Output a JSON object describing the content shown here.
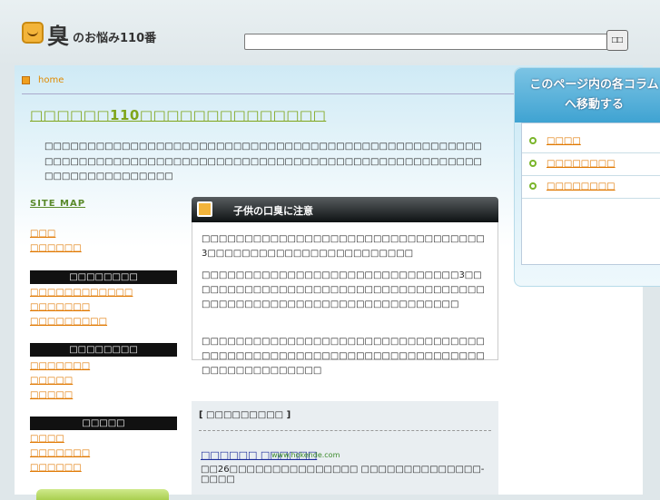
{
  "header": {
    "logo_kanji": "臭",
    "logo_text": "のお悩み110番",
    "search_value": "",
    "search_button": "□□"
  },
  "breadcrumb": {
    "home": "home"
  },
  "page_title": "□□□□□□110□□□□□□□□□□□□□□",
  "intro": "□□□□□□□□□□□□□□□□□□□□□□□□□□□□□□□□□□□□□□□□□□□□□□□□□□□□□□□□□□□□□□□□□□□□□□□□□□□□□□□□□□□□□□□□□□□□□□□□□□□□□□□□□□□□□□□□□□□□□",
  "sidebar": {
    "sitemap": "SITE MAP",
    "top_links": [
      "□□□",
      "□□□□□□"
    ],
    "groups": [
      {
        "title": "□□□□□□□□",
        "links": [
          "□□□□□□□□□□□□",
          "□□□□□□□",
          "□□□□□□□□□"
        ]
      },
      {
        "title": "□□□□□□□□",
        "links": [
          "□□□□□□□",
          "□□□□□",
          "□□□□□"
        ]
      },
      {
        "title": "□□□□□",
        "links": [
          "□□□□",
          "□□□□□□□",
          "□□□□□□"
        ]
      }
    ]
  },
  "article": {
    "title": "子供の口臭に注意",
    "paragraphs": [
      "□□□□□□□□□□□□□□□□□□□□□□□□□□□□□□□□□3□□□□□□□□□□□□□□□□□□□□□□□□",
      "□□□□□□□□□□□□□□□□□□□□□□□□□□□□□□3□□□□□□□□□□□□□□□□□□□□□□□□□□□□□□□□□□□□□□□□□□□□□□□□□□□□□□□□□□□□□□□□□",
      "□□□□□□□□□□□□□□□□□□□□□□□□□□□□□□□□□□□□□□□□□□□□□□□□□□□□□□□□□□□□□□□□□□□□□□□□□□□□□□□□"
    ]
  },
  "ad": {
    "heading": "[ □□□□□□□□□ ]",
    "link": "□□□□□□ □□□□□□",
    "url": "www.hokende.com",
    "desc": "□□26□□□□□□□□□□□□□□□ □□□□□□□□□□□□□□-□□□□"
  },
  "toc": {
    "title_line1": "このページ内の各コラム",
    "title_line2": "へ移動する",
    "items": [
      "□□□□",
      "□□□□□□□□",
      "□□□□□□□□"
    ]
  },
  "colors": {
    "accent": "#7fa51a",
    "link": "#e07800",
    "toc_head": "#3fa3d2"
  }
}
